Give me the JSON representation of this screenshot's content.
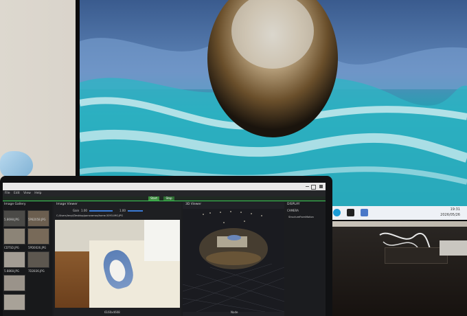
{
  "laptop": {
    "menu": [
      "File",
      "Edit",
      "View",
      "Help"
    ],
    "toolbar": {
      "start": "Start",
      "stop": "Stop"
    },
    "gallery": {
      "title": "Image Gallery",
      "files": [
        "5.8698.JPG",
        "5P82058.JPG",
        "CDTSD.JPG",
        "5PD0026.JPG",
        "5.8868.JPG",
        "7D2836.JPG"
      ]
    },
    "image_viewer": {
      "title": "Image Viewer",
      "gain_label": "Gain",
      "gain_value": "1.00",
      "gamma_value": "1.00",
      "path": "C:/Users/lenyi/Desktop/panoramas/home-5093-IMG.JPG",
      "resolution": "6160x4608"
    },
    "viewer3d": {
      "title": "3D Viewer",
      "footer": "Node"
    },
    "display_panel": {
      "title": "DISPLAY",
      "camera": "CAMERA",
      "item": "StructureFromMotion"
    }
  },
  "tv": {
    "time": "19:31",
    "date": "2026/05/26"
  }
}
